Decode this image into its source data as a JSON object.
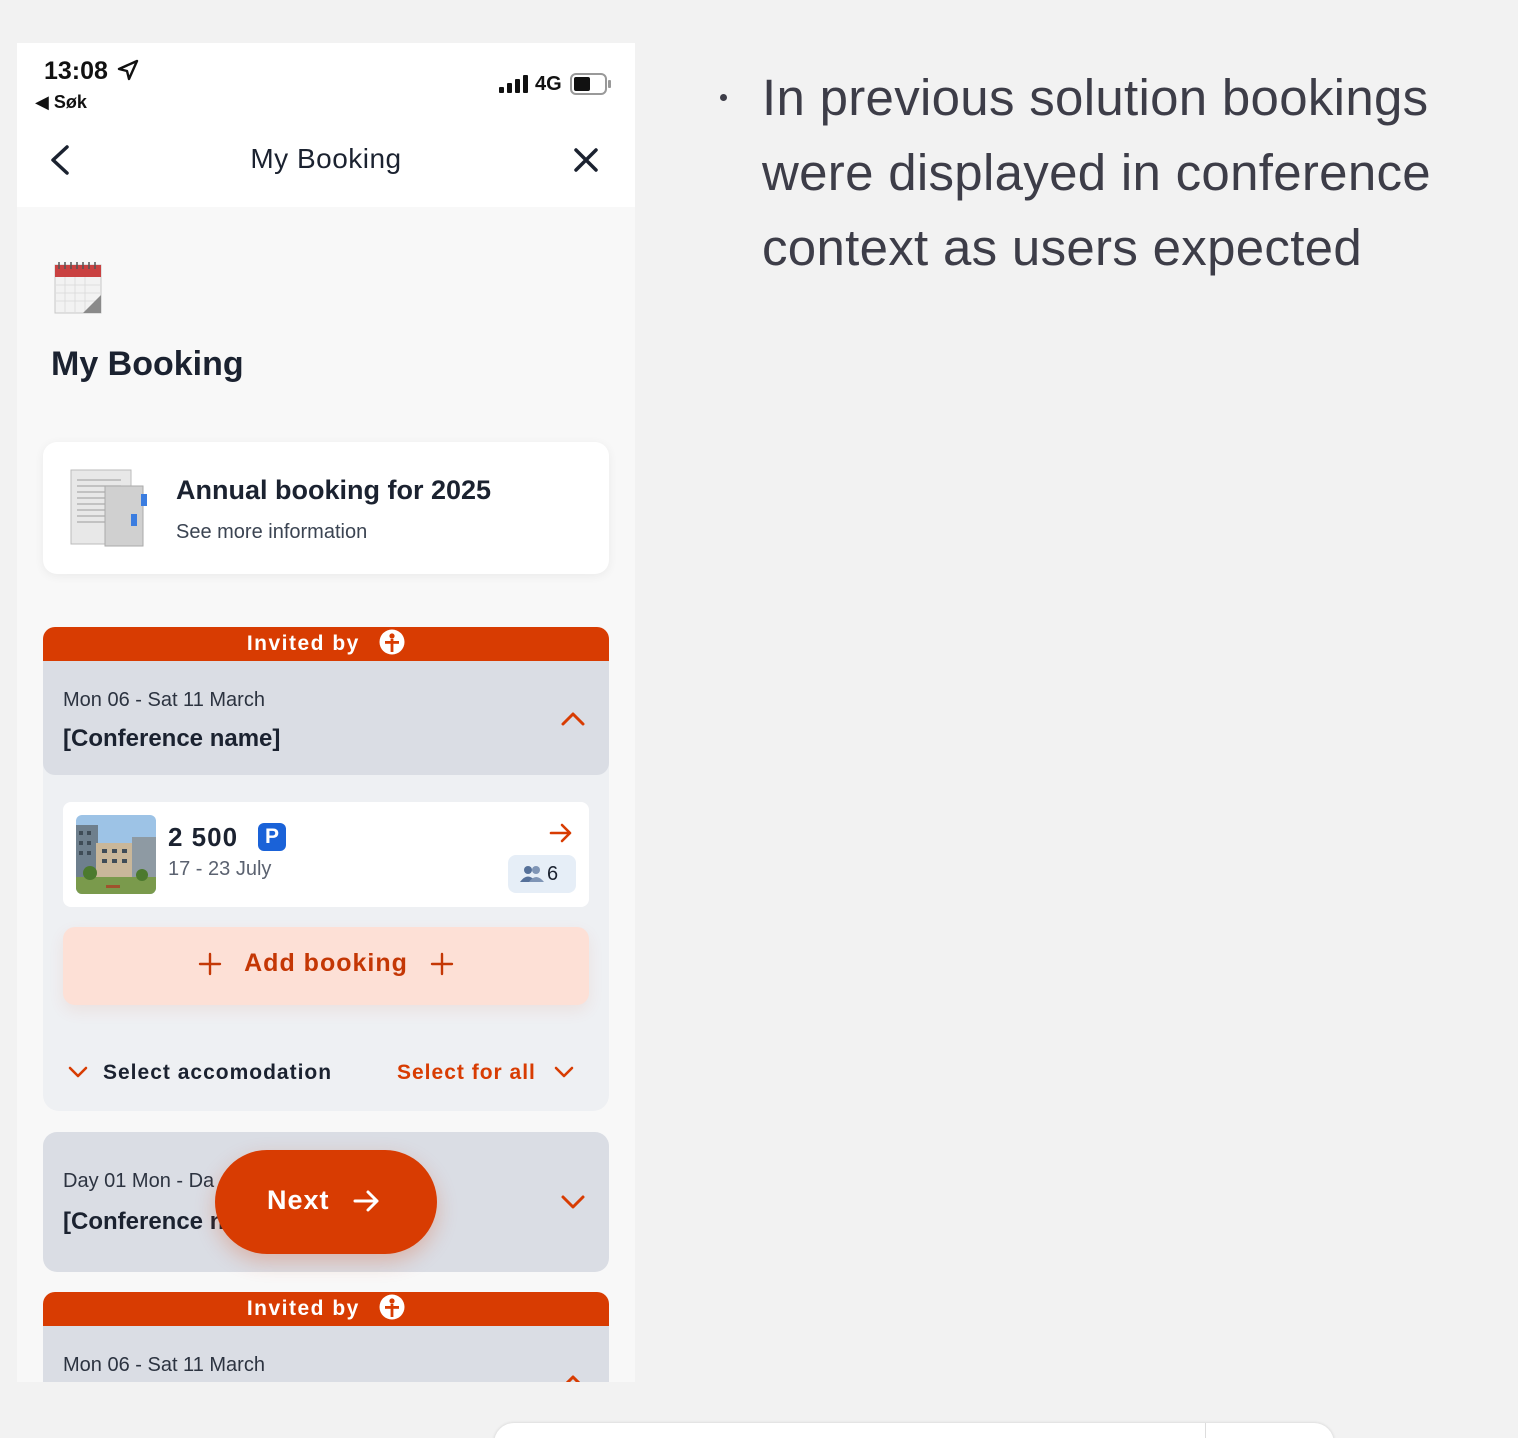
{
  "status_bar": {
    "time": "13:08",
    "back_app": "◀ Søk",
    "network": "4G"
  },
  "nav": {
    "title": "My Booking"
  },
  "page": {
    "title": "My Booking"
  },
  "annual_card": {
    "title": "Annual booking for 2025",
    "subtitle": "See more information"
  },
  "invited": {
    "label": "Invited by"
  },
  "conference_1": {
    "dates": "Mon 06 - Sat 11 March",
    "name": "[Conference name]",
    "booking": {
      "price": "2 500",
      "parking": "P",
      "dates": "17 - 23 July",
      "guests": "6"
    },
    "add_booking": "Add booking",
    "select_accommodation": "Select accomodation",
    "select_for_all": "Select for all"
  },
  "conference_2": {
    "dates": "Day 01 Mon - Da",
    "name": "[Conference n"
  },
  "next_button": {
    "label": "Next"
  },
  "conference_3": {
    "dates": "Mon 06 - Sat 11 March"
  },
  "bullet": {
    "text": "In previous solution bookings were displayed in conference context as users expected"
  },
  "colors": {
    "accent": "#d83c02",
    "accent_light": "#fde0d6",
    "card_gray": "#dadde4",
    "parking_blue": "#1a62d8"
  }
}
